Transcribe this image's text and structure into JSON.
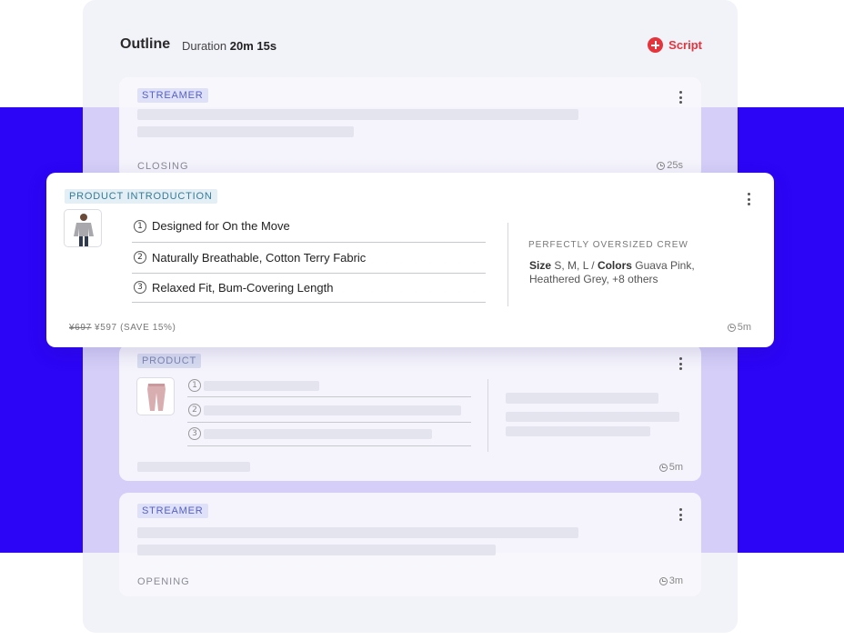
{
  "header": {
    "title": "Outline",
    "duration_label": "Duration",
    "duration_value": "20m 15s",
    "script_button": "Script"
  },
  "cards": {
    "streamer_closing": {
      "tag": "STREAMER",
      "footer": "CLOSING",
      "time": "25s"
    },
    "product_intro": {
      "tag": "PRODUCT INTRODUCTION",
      "features": [
        {
          "num": "1",
          "text": "Designed for On the Move"
        },
        {
          "num": "2",
          "text": "Naturally Breathable, Cotton Terry Fabric"
        },
        {
          "num": "3",
          "text": "Relaxed Fit, Bum-Covering Length"
        }
      ],
      "spec_title": "PERFECTLY OVERSIZED CREW",
      "size_label": "Size",
      "size_value": "S, M, L /",
      "colors_label": "Colors",
      "colors_value": "Guava Pink, Heathered Grey, +8 others",
      "price_old": "¥697",
      "price_new": "¥597 (SAVE 15%)",
      "time": "5m"
    },
    "product": {
      "tag": "PRODUCT",
      "nums": [
        "1",
        "2",
        "3"
      ],
      "time": "5m"
    },
    "streamer_opening": {
      "tag": "STREAMER",
      "footer": "OPENING",
      "time": "3m"
    }
  },
  "icons": {
    "script": "plus-circle-icon",
    "menu": "kebab-menu-icon",
    "clock": "clock-icon"
  },
  "colors": {
    "background_band": "#2c04f6",
    "accent_red": "#e5343c"
  }
}
